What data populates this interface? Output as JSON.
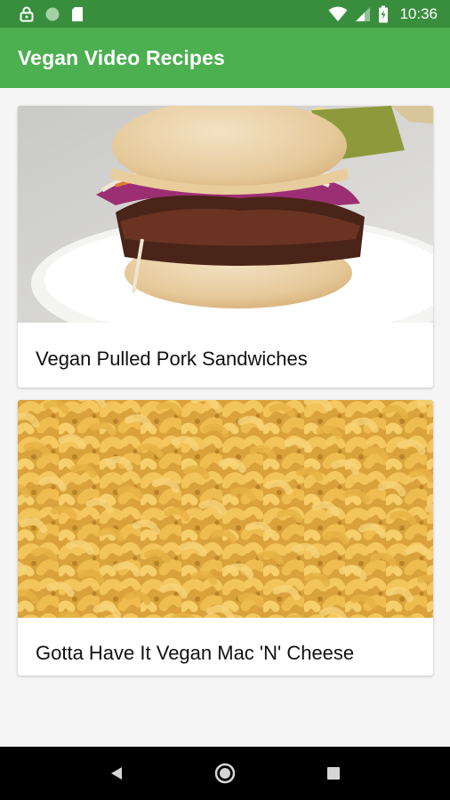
{
  "status_bar": {
    "time": "10:36",
    "icons": [
      "lock-icon",
      "circle-icon",
      "sd-card-icon",
      "wifi-icon",
      "signal-icon",
      "battery-icon"
    ]
  },
  "app_bar": {
    "title": "Vegan Video Recipes",
    "color": "#4caf50",
    "status_color": "#388e3c"
  },
  "recipes": [
    {
      "title": "Vegan Pulled Pork Sandwiches",
      "image": "pulled-pork-sandwich-photo"
    },
    {
      "title": "Gotta Have It Vegan Mac 'N' Cheese",
      "image": "mac-and-cheese-photo"
    }
  ],
  "nav_bar": {
    "icons": [
      "back-icon",
      "home-icon",
      "recents-icon"
    ]
  }
}
